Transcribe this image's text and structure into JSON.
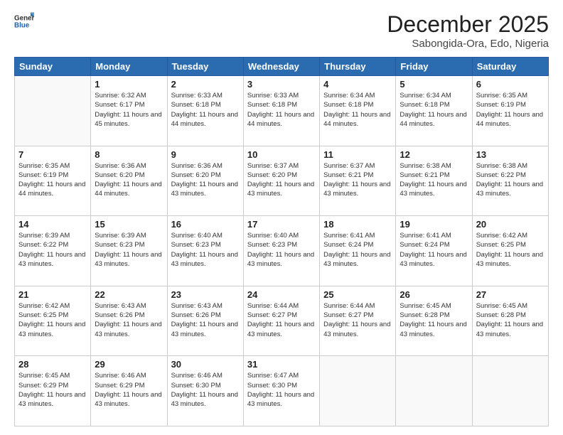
{
  "header": {
    "logo_general": "General",
    "logo_blue": "Blue",
    "month_title": "December 2025",
    "location": "Sabongida-Ora, Edo, Nigeria"
  },
  "weekdays": [
    "Sunday",
    "Monday",
    "Tuesday",
    "Wednesday",
    "Thursday",
    "Friday",
    "Saturday"
  ],
  "weeks": [
    [
      {
        "day": "",
        "sunrise": "",
        "sunset": "",
        "daylight": ""
      },
      {
        "day": "1",
        "sunrise": "Sunrise: 6:32 AM",
        "sunset": "Sunset: 6:17 PM",
        "daylight": "Daylight: 11 hours and 45 minutes."
      },
      {
        "day": "2",
        "sunrise": "Sunrise: 6:33 AM",
        "sunset": "Sunset: 6:18 PM",
        "daylight": "Daylight: 11 hours and 44 minutes."
      },
      {
        "day": "3",
        "sunrise": "Sunrise: 6:33 AM",
        "sunset": "Sunset: 6:18 PM",
        "daylight": "Daylight: 11 hours and 44 minutes."
      },
      {
        "day": "4",
        "sunrise": "Sunrise: 6:34 AM",
        "sunset": "Sunset: 6:18 PM",
        "daylight": "Daylight: 11 hours and 44 minutes."
      },
      {
        "day": "5",
        "sunrise": "Sunrise: 6:34 AM",
        "sunset": "Sunset: 6:18 PM",
        "daylight": "Daylight: 11 hours and 44 minutes."
      },
      {
        "day": "6",
        "sunrise": "Sunrise: 6:35 AM",
        "sunset": "Sunset: 6:19 PM",
        "daylight": "Daylight: 11 hours and 44 minutes."
      }
    ],
    [
      {
        "day": "7",
        "sunrise": "Sunrise: 6:35 AM",
        "sunset": "Sunset: 6:19 PM",
        "daylight": "Daylight: 11 hours and 44 minutes."
      },
      {
        "day": "8",
        "sunrise": "Sunrise: 6:36 AM",
        "sunset": "Sunset: 6:20 PM",
        "daylight": "Daylight: 11 hours and 44 minutes."
      },
      {
        "day": "9",
        "sunrise": "Sunrise: 6:36 AM",
        "sunset": "Sunset: 6:20 PM",
        "daylight": "Daylight: 11 hours and 43 minutes."
      },
      {
        "day": "10",
        "sunrise": "Sunrise: 6:37 AM",
        "sunset": "Sunset: 6:20 PM",
        "daylight": "Daylight: 11 hours and 43 minutes."
      },
      {
        "day": "11",
        "sunrise": "Sunrise: 6:37 AM",
        "sunset": "Sunset: 6:21 PM",
        "daylight": "Daylight: 11 hours and 43 minutes."
      },
      {
        "day": "12",
        "sunrise": "Sunrise: 6:38 AM",
        "sunset": "Sunset: 6:21 PM",
        "daylight": "Daylight: 11 hours and 43 minutes."
      },
      {
        "day": "13",
        "sunrise": "Sunrise: 6:38 AM",
        "sunset": "Sunset: 6:22 PM",
        "daylight": "Daylight: 11 hours and 43 minutes."
      }
    ],
    [
      {
        "day": "14",
        "sunrise": "Sunrise: 6:39 AM",
        "sunset": "Sunset: 6:22 PM",
        "daylight": "Daylight: 11 hours and 43 minutes."
      },
      {
        "day": "15",
        "sunrise": "Sunrise: 6:39 AM",
        "sunset": "Sunset: 6:23 PM",
        "daylight": "Daylight: 11 hours and 43 minutes."
      },
      {
        "day": "16",
        "sunrise": "Sunrise: 6:40 AM",
        "sunset": "Sunset: 6:23 PM",
        "daylight": "Daylight: 11 hours and 43 minutes."
      },
      {
        "day": "17",
        "sunrise": "Sunrise: 6:40 AM",
        "sunset": "Sunset: 6:23 PM",
        "daylight": "Daylight: 11 hours and 43 minutes."
      },
      {
        "day": "18",
        "sunrise": "Sunrise: 6:41 AM",
        "sunset": "Sunset: 6:24 PM",
        "daylight": "Daylight: 11 hours and 43 minutes."
      },
      {
        "day": "19",
        "sunrise": "Sunrise: 6:41 AM",
        "sunset": "Sunset: 6:24 PM",
        "daylight": "Daylight: 11 hours and 43 minutes."
      },
      {
        "day": "20",
        "sunrise": "Sunrise: 6:42 AM",
        "sunset": "Sunset: 6:25 PM",
        "daylight": "Daylight: 11 hours and 43 minutes."
      }
    ],
    [
      {
        "day": "21",
        "sunrise": "Sunrise: 6:42 AM",
        "sunset": "Sunset: 6:25 PM",
        "daylight": "Daylight: 11 hours and 43 minutes."
      },
      {
        "day": "22",
        "sunrise": "Sunrise: 6:43 AM",
        "sunset": "Sunset: 6:26 PM",
        "daylight": "Daylight: 11 hours and 43 minutes."
      },
      {
        "day": "23",
        "sunrise": "Sunrise: 6:43 AM",
        "sunset": "Sunset: 6:26 PM",
        "daylight": "Daylight: 11 hours and 43 minutes."
      },
      {
        "day": "24",
        "sunrise": "Sunrise: 6:44 AM",
        "sunset": "Sunset: 6:27 PM",
        "daylight": "Daylight: 11 hours and 43 minutes."
      },
      {
        "day": "25",
        "sunrise": "Sunrise: 6:44 AM",
        "sunset": "Sunset: 6:27 PM",
        "daylight": "Daylight: 11 hours and 43 minutes."
      },
      {
        "day": "26",
        "sunrise": "Sunrise: 6:45 AM",
        "sunset": "Sunset: 6:28 PM",
        "daylight": "Daylight: 11 hours and 43 minutes."
      },
      {
        "day": "27",
        "sunrise": "Sunrise: 6:45 AM",
        "sunset": "Sunset: 6:28 PM",
        "daylight": "Daylight: 11 hours and 43 minutes."
      }
    ],
    [
      {
        "day": "28",
        "sunrise": "Sunrise: 6:45 AM",
        "sunset": "Sunset: 6:29 PM",
        "daylight": "Daylight: 11 hours and 43 minutes."
      },
      {
        "day": "29",
        "sunrise": "Sunrise: 6:46 AM",
        "sunset": "Sunset: 6:29 PM",
        "daylight": "Daylight: 11 hours and 43 minutes."
      },
      {
        "day": "30",
        "sunrise": "Sunrise: 6:46 AM",
        "sunset": "Sunset: 6:30 PM",
        "daylight": "Daylight: 11 hours and 43 minutes."
      },
      {
        "day": "31",
        "sunrise": "Sunrise: 6:47 AM",
        "sunset": "Sunset: 6:30 PM",
        "daylight": "Daylight: 11 hours and 43 minutes."
      },
      {
        "day": "",
        "sunrise": "",
        "sunset": "",
        "daylight": ""
      },
      {
        "day": "",
        "sunrise": "",
        "sunset": "",
        "daylight": ""
      },
      {
        "day": "",
        "sunrise": "",
        "sunset": "",
        "daylight": ""
      }
    ]
  ]
}
